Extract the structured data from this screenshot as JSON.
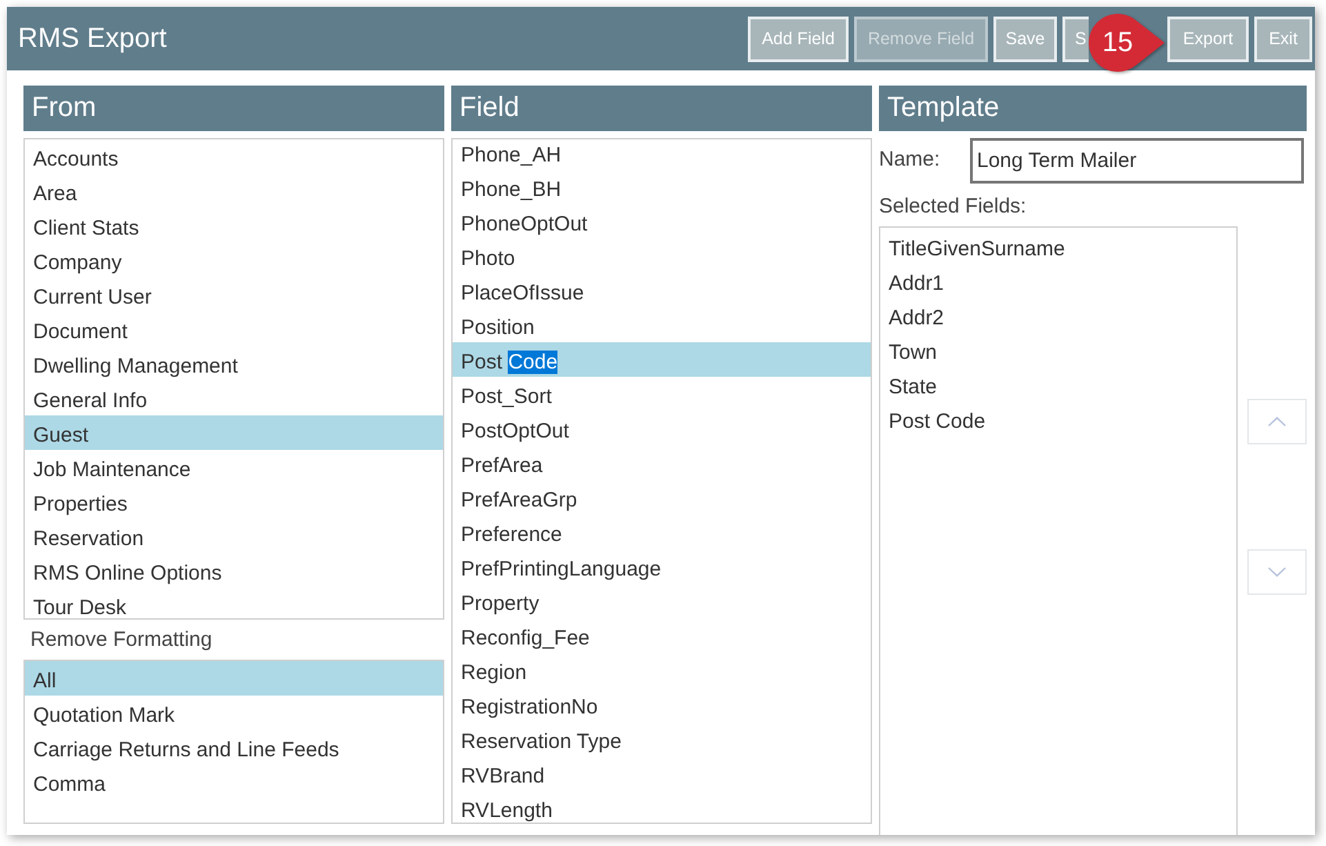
{
  "window": {
    "title": "RMS Export"
  },
  "toolbar": [
    {
      "label": "Add Field",
      "disabled": false
    },
    {
      "label": "Remove Field",
      "disabled": true
    },
    {
      "label": "Save",
      "disabled": false
    },
    {
      "label": "S",
      "disabled": false
    },
    {
      "label": "Export",
      "disabled": false
    },
    {
      "label": "Exit",
      "disabled": false
    }
  ],
  "callout": {
    "text": "15"
  },
  "from": {
    "heading": "From",
    "items": [
      {
        "label": "Accounts",
        "selected": false
      },
      {
        "label": "Area",
        "selected": false
      },
      {
        "label": "Client Stats",
        "selected": false
      },
      {
        "label": "Company",
        "selected": false
      },
      {
        "label": "Current User",
        "selected": false
      },
      {
        "label": "Document",
        "selected": false
      },
      {
        "label": "Dwelling Management",
        "selected": false
      },
      {
        "label": "General Info",
        "selected": false
      },
      {
        "label": "Guest",
        "selected": true
      },
      {
        "label": "Job Maintenance",
        "selected": false
      },
      {
        "label": "Properties",
        "selected": false
      },
      {
        "label": "Reservation",
        "selected": false
      },
      {
        "label": "RMS Online Options",
        "selected": false
      },
      {
        "label": "Tour Desk",
        "selected": false
      }
    ]
  },
  "remove_formatting": {
    "label": "Remove Formatting",
    "items": [
      {
        "label": "All",
        "selected": true
      },
      {
        "label": "Quotation Mark",
        "selected": false
      },
      {
        "label": "Carriage Returns and Line Feeds",
        "selected": false
      },
      {
        "label": "Comma",
        "selected": false
      }
    ]
  },
  "field": {
    "heading": "Field",
    "items": [
      {
        "label": "Phone_AH",
        "selected": false
      },
      {
        "label": "Phone_BH",
        "selected": false
      },
      {
        "label": "PhoneOptOut",
        "selected": false
      },
      {
        "label": "Photo",
        "selected": false
      },
      {
        "label": "PlaceOfIssue",
        "selected": false
      },
      {
        "label": "Position",
        "selected": false
      },
      {
        "label": "Post",
        "highlighted_text": "Code",
        "selected": true
      },
      {
        "label": "Post_Sort",
        "selected": false
      },
      {
        "label": "PostOptOut",
        "selected": false
      },
      {
        "label": "PrefArea",
        "selected": false
      },
      {
        "label": "PrefAreaGrp",
        "selected": false
      },
      {
        "label": "Preference",
        "selected": false
      },
      {
        "label": "PrefPrintingLanguage",
        "selected": false
      },
      {
        "label": "Property",
        "selected": false
      },
      {
        "label": "Reconfig_Fee",
        "selected": false
      },
      {
        "label": "Region",
        "selected": false
      },
      {
        "label": "RegistrationNo",
        "selected": false
      },
      {
        "label": "Reservation Type",
        "selected": false
      },
      {
        "label": "RVBrand",
        "selected": false
      },
      {
        "label": "RVLength",
        "selected": false
      }
    ]
  },
  "template": {
    "heading": "Template",
    "name_label": "Name:",
    "name_value": "Long Term Mailer",
    "selected_fields_label": "Selected Fields:",
    "selected_fields": [
      {
        "label": "TitleGivenSurname",
        "selected": false
      },
      {
        "label": "Addr1",
        "selected": false
      },
      {
        "label": "Addr2",
        "selected": false
      },
      {
        "label": "Town",
        "selected": false
      },
      {
        "label": "State",
        "selected": false
      },
      {
        "label": "Post Code",
        "selected": false
      }
    ]
  }
}
